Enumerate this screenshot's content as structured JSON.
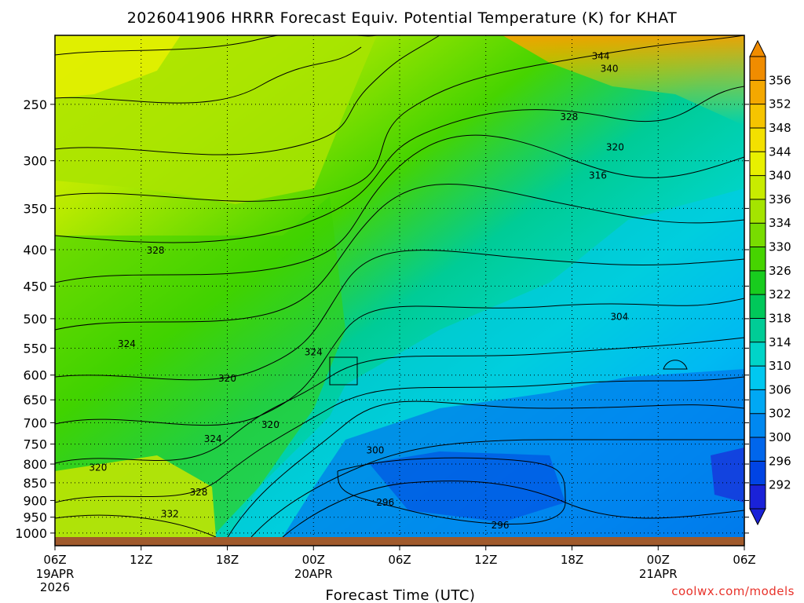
{
  "chart_data": {
    "type": "heatmap",
    "title": "2026041906 HRRR Forecast Equiv. Potential Temperature (K) for KHAT",
    "xlabel": "Forecast Time (UTC)",
    "ylabel": "",
    "x_ticks": [
      {
        "label": "06Z",
        "sub1": "19APR",
        "sub2": "2026",
        "hour": 0
      },
      {
        "label": "12Z",
        "sub1": "",
        "sub2": "",
        "hour": 6
      },
      {
        "label": "18Z",
        "sub1": "",
        "sub2": "",
        "hour": 12
      },
      {
        "label": "00Z",
        "sub1": "20APR",
        "sub2": "",
        "hour": 18
      },
      {
        "label": "06Z",
        "sub1": "",
        "sub2": "",
        "hour": 24
      },
      {
        "label": "12Z",
        "sub1": "",
        "sub2": "",
        "hour": 30
      },
      {
        "label": "18Z",
        "sub1": "",
        "sub2": "",
        "hour": 36
      },
      {
        "label": "00Z",
        "sub1": "21APR",
        "sub2": "",
        "hour": 42
      },
      {
        "label": "06Z",
        "sub1": "",
        "sub2": "",
        "hour": 48
      }
    ],
    "xlim": [
      0,
      48
    ],
    "y_ticks": [
      "250",
      "300",
      "350",
      "400",
      "450",
      "500",
      "550",
      "600",
      "650",
      "700",
      "750",
      "800",
      "850",
      "900",
      "950",
      "1000"
    ],
    "y_tick_values": [
      250,
      300,
      350,
      400,
      450,
      500,
      550,
      600,
      650,
      700,
      750,
      800,
      850,
      900,
      950,
      1000
    ],
    "ylim": [
      1013,
      200
    ],
    "y_scale": "log",
    "grid": true,
    "colorbar": {
      "labels": [
        "356",
        "352",
        "348",
        "344",
        "340",
        "336",
        "334",
        "330",
        "326",
        "322",
        "318",
        "314",
        "310",
        "306",
        "302",
        "300",
        "296",
        "292"
      ],
      "colors": [
        "#f08c00",
        "#f4a800",
        "#f6c400",
        "#f3e000",
        "#e8f000",
        "#c8ec00",
        "#a4e400",
        "#78dc00",
        "#46d400",
        "#18cc1e",
        "#00c85a",
        "#00cc96",
        "#00d4c8",
        "#00c8f0",
        "#00a8f4",
        "#0088f0",
        "#0066ec",
        "#0044e4",
        "#1a22d8"
      ]
    },
    "contour_labels": [
      {
        "text": "344",
        "hour": 38.0,
        "p": 216
      },
      {
        "text": "340",
        "hour": 38.6,
        "p": 225
      },
      {
        "text": "328",
        "hour": 35.8,
        "p": 263
      },
      {
        "text": "320",
        "hour": 39.0,
        "p": 290
      },
      {
        "text": "316",
        "hour": 37.8,
        "p": 318
      },
      {
        "text": "328",
        "hour": 7.0,
        "p": 405
      },
      {
        "text": "304",
        "hour": 39.3,
        "p": 502
      },
      {
        "text": "324",
        "hour": 5.0,
        "p": 548
      },
      {
        "text": "324",
        "hour": 18.0,
        "p": 563
      },
      {
        "text": "320",
        "hour": 12.0,
        "p": 613
      },
      {
        "text": "320",
        "hour": 15.0,
        "p": 712
      },
      {
        "text": "324",
        "hour": 11.0,
        "p": 745
      },
      {
        "text": "300",
        "hour": 22.3,
        "p": 773
      },
      {
        "text": "320",
        "hour": 3.0,
        "p": 817
      },
      {
        "text": "328",
        "hour": 10.0,
        "p": 886
      },
      {
        "text": "296",
        "hour": 23.0,
        "p": 915
      },
      {
        "text": "332",
        "hour": 8.0,
        "p": 950
      },
      {
        "text": "296",
        "hour": 31.0,
        "p": 985
      }
    ]
  },
  "credit": "coolwx.com/models"
}
